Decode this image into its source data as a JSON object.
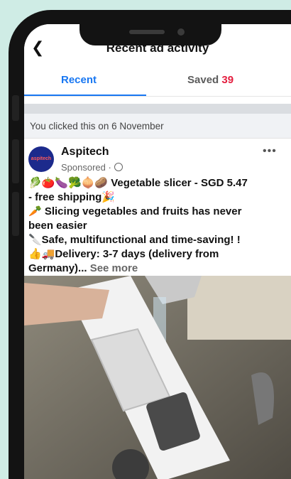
{
  "header": {
    "back_icon": "chevron-left-icon",
    "title": "Recent ad activity"
  },
  "tabs": [
    {
      "label": "Recent",
      "active": true
    },
    {
      "label": "Saved",
      "count": "39"
    }
  ],
  "activity": {
    "clicked_text": "You clicked this on 6 November"
  },
  "ad": {
    "avatar_text": "aspitech",
    "page_name": "Aspitech",
    "sponsored_label": "Sponsored ·",
    "privacy_icon": "globe-icon",
    "menu_icon": "more-horizontal-icon",
    "lines": [
      "🥬🍅🍆🥦🧅🥔 Vegetable slicer - SGD 5.47",
      "- free shipping🎉",
      "🥕 Slicing vegetables and fruits has never",
      "been easier",
      "🔪Safe, multifunctional and time-saving! !",
      "👍🚚Delivery: 3-7 days (delivery from",
      "Germany)..."
    ],
    "see_more": "See more",
    "image_description_icon": "vegetable-slicer-photo"
  },
  "colors": {
    "accent": "#1877f2",
    "count_red": "#e41e3f",
    "background": "#cfece5"
  }
}
